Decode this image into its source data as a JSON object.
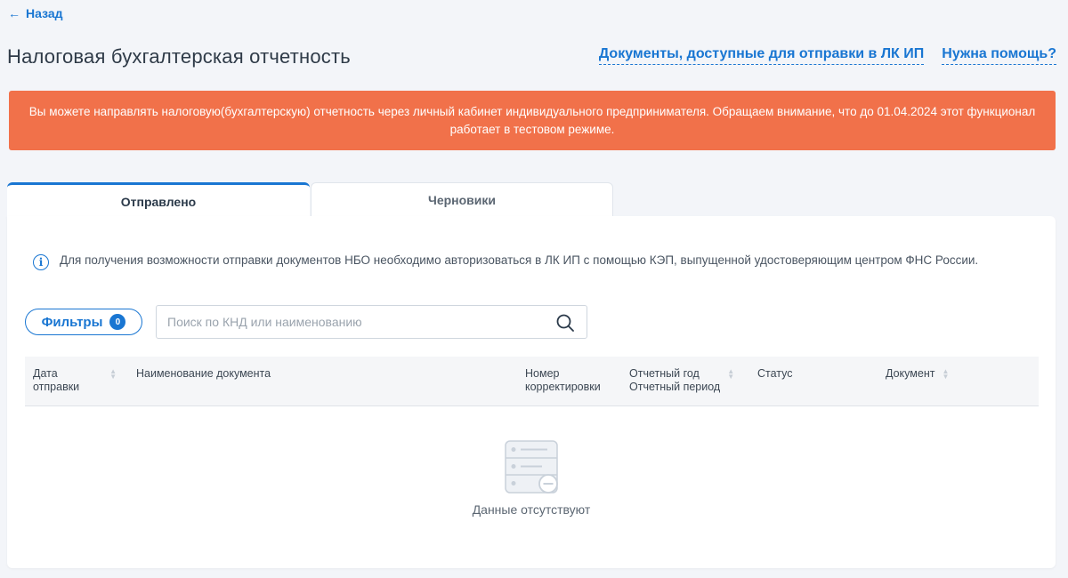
{
  "nav": {
    "back_label": "Назад"
  },
  "page": {
    "title": "Налоговая бухгалтерская отчетность"
  },
  "header_links": {
    "documents": "Документы, доступные для отправки в ЛК ИП",
    "help": "Нужна помощь?"
  },
  "alert": {
    "text": "Вы можете направлять налоговую(бухгалтерскую) отчетность через личный кабинет индивидуального предпринимателя. Обращаем внимание, что до 01.04.2024 этот функционал работает в тестовом режиме.",
    "color": "#f1714a"
  },
  "tabs": [
    {
      "label": "Отправлено",
      "active": true
    },
    {
      "label": "Черновики",
      "active": false
    }
  ],
  "info": {
    "icon": "info-icon",
    "text": "Для получения возможности отправки документов НБО необходимо авторизоваться в ЛК ИП с помощью КЭП, выпущенной удостоверяющим центром ФНС России."
  },
  "filters": {
    "label": "Фильтры",
    "count": "0"
  },
  "search": {
    "placeholder": "Поиск по КНД или наименованию",
    "value": ""
  },
  "table": {
    "columns": [
      {
        "line1": "Дата",
        "line2": "отправки",
        "sortable": true
      },
      {
        "line1": "Наименование документа",
        "line2": "",
        "sortable": false
      },
      {
        "line1": "Номер",
        "line2": "корректировки",
        "sortable": false
      },
      {
        "line1": "Отчетный год",
        "line2": "Отчетный период",
        "sortable": true
      },
      {
        "line1": "Статус",
        "line2": "",
        "sortable": false
      },
      {
        "line1": "Документ",
        "line2": "",
        "sortable": true
      }
    ],
    "rows": []
  },
  "empty_state": {
    "icon": "empty-list-icon",
    "text": "Данные отсутствуют"
  },
  "colors": {
    "accent": "#1976d2",
    "alert": "#f1714a",
    "background": "#f3f5f9"
  }
}
